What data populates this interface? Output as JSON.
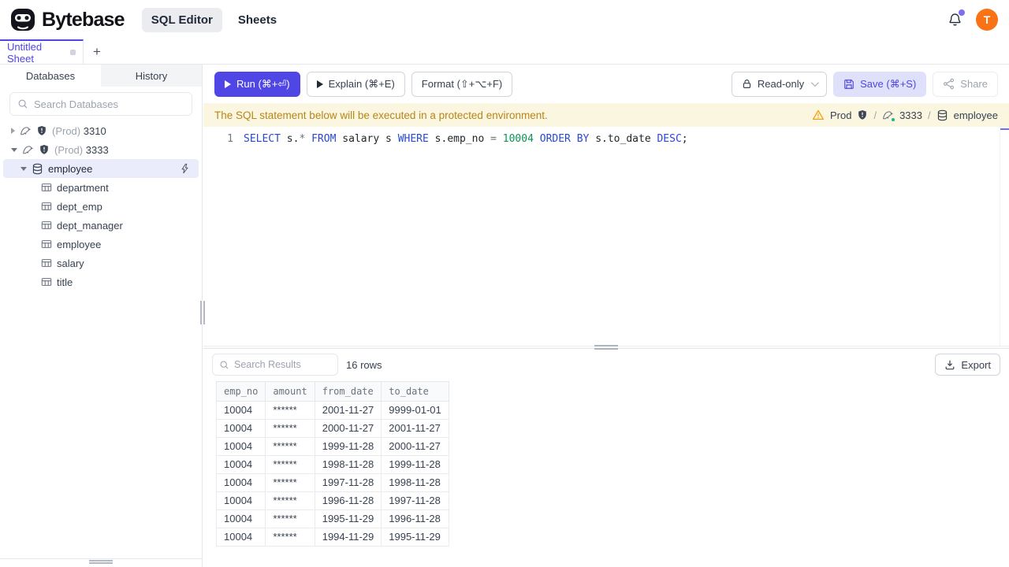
{
  "header": {
    "brand": "Bytebase",
    "nav": [
      {
        "label": "SQL Editor",
        "active": true
      },
      {
        "label": "Sheets",
        "active": false
      }
    ],
    "avatar": "T"
  },
  "tabs": {
    "active_tab": "Untitled Sheet",
    "add": "+"
  },
  "sidebar": {
    "tab_databases": "Databases",
    "tab_history": "History",
    "search_placeholder": "Search Databases",
    "instances": [
      {
        "env": "(Prod)",
        "name": "3310",
        "expanded": false
      },
      {
        "env": "(Prod)",
        "name": "3333",
        "expanded": true
      }
    ],
    "database": "employee",
    "tables": [
      "department",
      "dept_emp",
      "dept_manager",
      "employee",
      "salary",
      "title"
    ]
  },
  "toolbar": {
    "run": "Run (⌘+⏎)",
    "explain": "Explain (⌘+E)",
    "format": "Format (⇧+⌥+F)",
    "readonly": "Read-only",
    "save": "Save (⌘+S)",
    "share": "Share"
  },
  "banner": {
    "message": "The SQL statement below will be executed in a protected environment.",
    "env": "Prod",
    "sep": "/",
    "instance": "3333",
    "database": "employee"
  },
  "editor": {
    "line_number": "1",
    "sql": "SELECT s.* FROM salary s WHERE s.emp_no = 10004 ORDER BY s.to_date DESC;",
    "tokens": [
      {
        "text": "SELECT",
        "type": "keyword"
      },
      {
        "text": " s.",
        "type": "plain"
      },
      {
        "text": "*",
        "type": "operator"
      },
      {
        "text": " ",
        "type": "plain"
      },
      {
        "text": "FROM",
        "type": "keyword"
      },
      {
        "text": " salary s ",
        "type": "plain"
      },
      {
        "text": "WHERE",
        "type": "keyword"
      },
      {
        "text": " s.emp_no ",
        "type": "plain"
      },
      {
        "text": "=",
        "type": "operator"
      },
      {
        "text": " ",
        "type": "plain"
      },
      {
        "text": "10004",
        "type": "number"
      },
      {
        "text": " ",
        "type": "plain"
      },
      {
        "text": "ORDER BY",
        "type": "keyword"
      },
      {
        "text": " s.to_date ",
        "type": "plain"
      },
      {
        "text": "DESC",
        "type": "keyword"
      },
      {
        "text": ";",
        "type": "plain"
      }
    ]
  },
  "results": {
    "search_placeholder": "Search Results",
    "row_count": "16 rows",
    "export": "Export",
    "table": {
      "columns": [
        "emp_no",
        "amount",
        "from_date",
        "to_date"
      ],
      "rows": [
        [
          "10004",
          "******",
          "2001-11-27",
          "9999-01-01"
        ],
        [
          "10004",
          "******",
          "2000-11-27",
          "2001-11-27"
        ],
        [
          "10004",
          "******",
          "1999-11-28",
          "2000-11-27"
        ],
        [
          "10004",
          "******",
          "1998-11-28",
          "1999-11-28"
        ],
        [
          "10004",
          "******",
          "1997-11-28",
          "1998-11-28"
        ],
        [
          "10004",
          "******",
          "1996-11-28",
          "1997-11-28"
        ],
        [
          "10004",
          "******",
          "1995-11-29",
          "1996-11-28"
        ],
        [
          "10004",
          "******",
          "1994-11-29",
          "1995-11-29"
        ]
      ]
    }
  },
  "colors": {
    "accent": "#4f46e5",
    "run_button": "#5046e5",
    "save_button_bg": "#dfe1fb",
    "avatar_bg": "#f97316",
    "banner_bg": "#fbf6e0",
    "banner_text": "#b7861b",
    "sql_keyword": "#2948d1",
    "sql_number": "#0d9157",
    "selected_tree_row_bg": "#ebecfb",
    "warning_icon": "#f59e0b",
    "status_green": "#10b981",
    "notification_dot": "#7c6ff0"
  }
}
